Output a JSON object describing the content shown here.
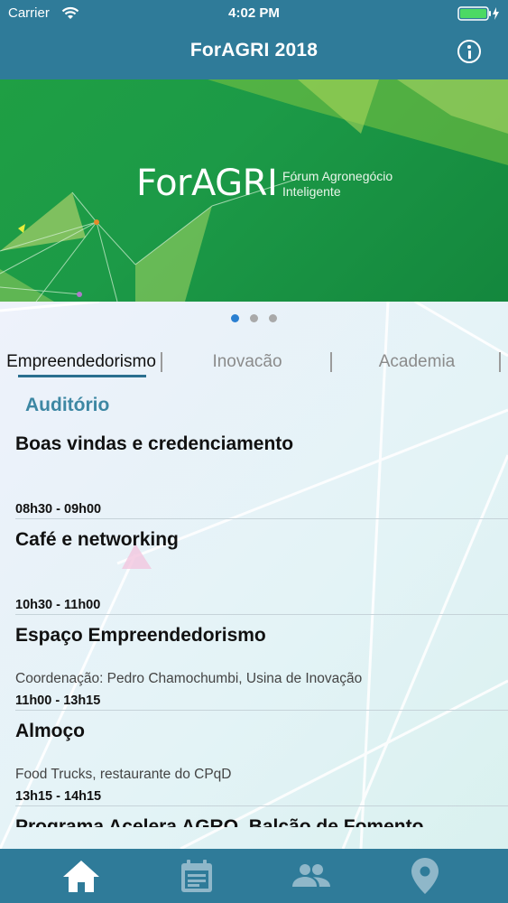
{
  "status_bar": {
    "carrier": "Carrier",
    "time": "4:02 PM"
  },
  "header": {
    "title": "ForAGRI 2018",
    "info_icon": "info-icon"
  },
  "banner": {
    "brand": "ForAGRI",
    "tagline_line1": "Fórum Agronegócio",
    "tagline_line2": "Inteligente",
    "page_count": 3,
    "active_page": 0
  },
  "tabs": [
    {
      "label": "Empreendedorismo",
      "active": true
    },
    {
      "label": "Inovacão",
      "active": false
    },
    {
      "label": "Academia",
      "active": false
    }
  ],
  "location": "Auditório",
  "sessions": [
    {
      "title": "Boas vindas e credenciamento",
      "description": "",
      "time": "08h30 - 09h00"
    },
    {
      "title": "Café e networking",
      "description": "",
      "time": "10h30 - 11h00"
    },
    {
      "title": "Espaço Empreendedorismo",
      "description": "Coordenação: Pedro Chamochumbi, Usina de Inovação",
      "time": "11h00 - 13h15"
    },
    {
      "title": "Almoço",
      "description": "Food Trucks, restaurante do CPqD",
      "time": "13h15 - 14h15"
    },
    {
      "title": "Programa Acelera AGRO, Balcão de Fomento",
      "description": "",
      "time": ""
    }
  ],
  "tab_bar": [
    {
      "icon": "home-icon",
      "selected": true
    },
    {
      "icon": "calendar-icon",
      "selected": false
    },
    {
      "icon": "people-icon",
      "selected": false
    },
    {
      "icon": "location-pin-icon",
      "selected": false
    }
  ],
  "colors": {
    "header": "#2f7b99",
    "accent": "#3d87a3",
    "active_dot": "#2a7fd1"
  }
}
